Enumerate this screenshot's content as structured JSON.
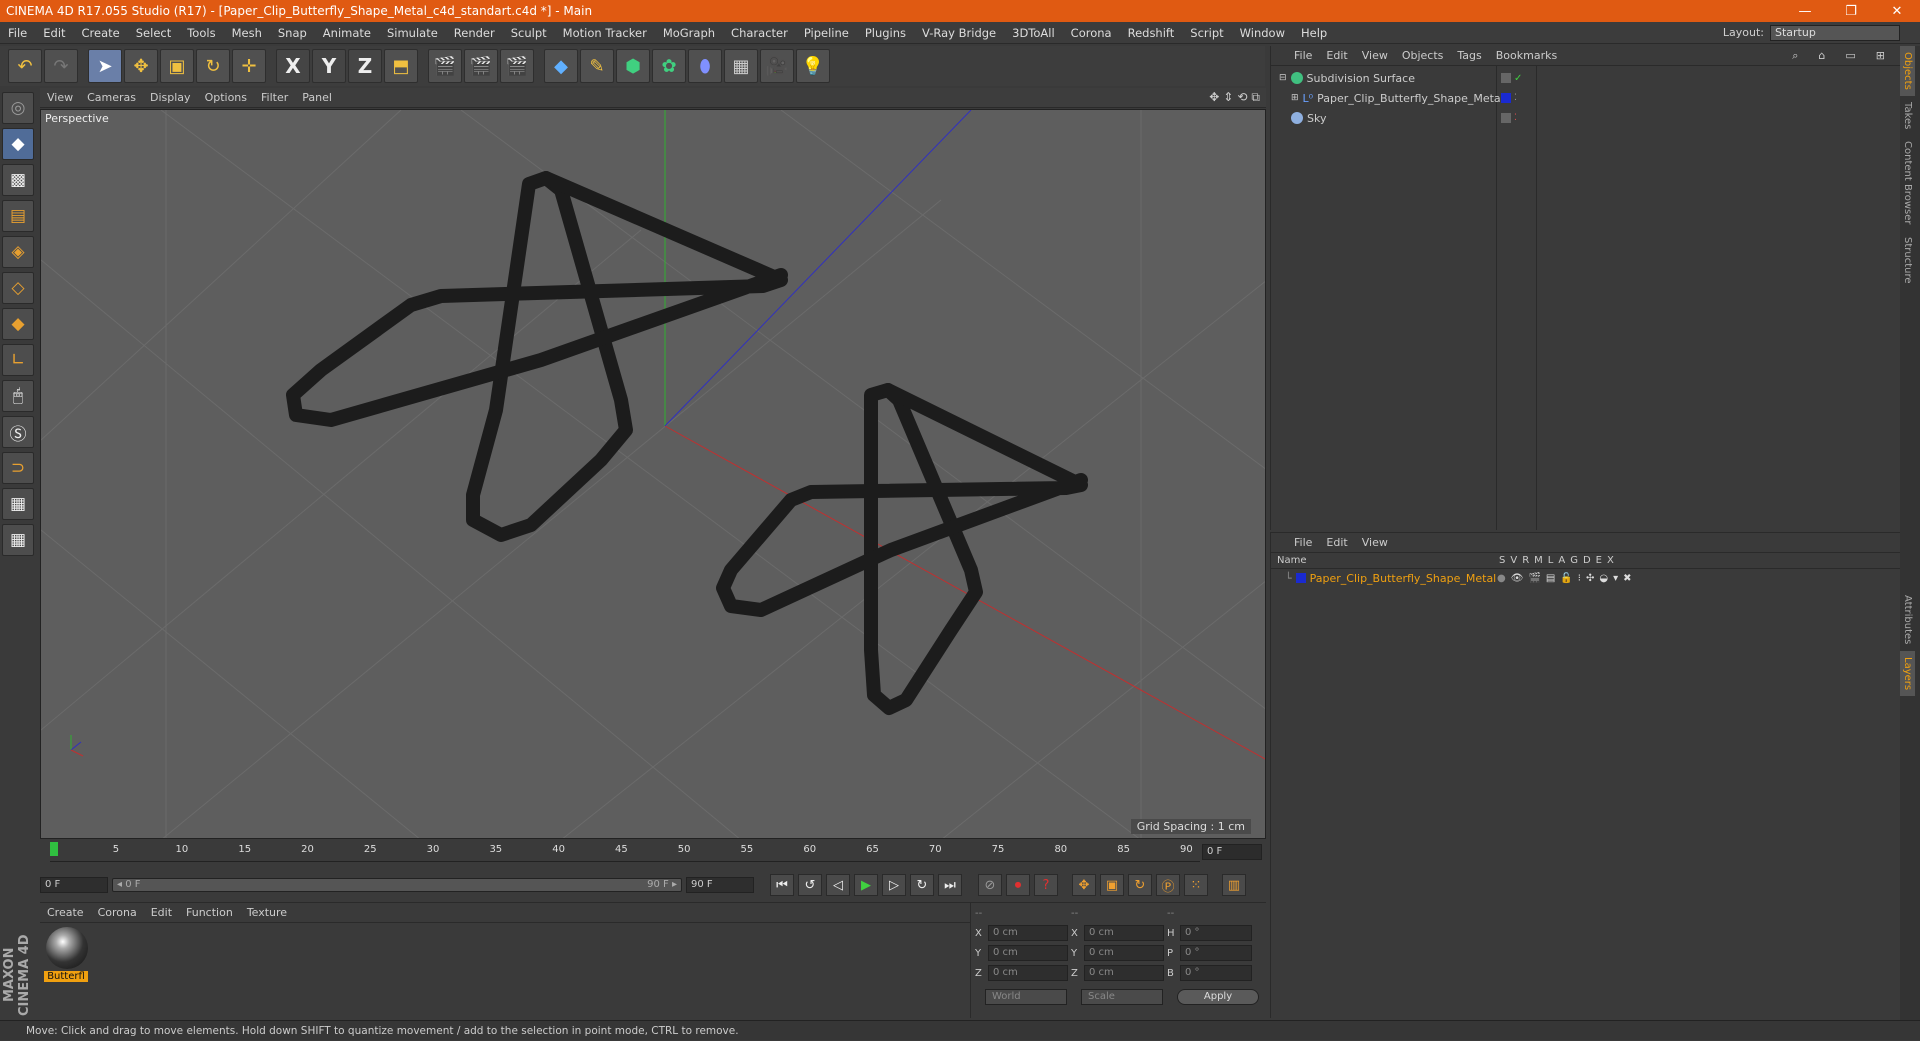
{
  "window": {
    "title": "CINEMA 4D R17.055 Studio (R17) - [Paper_Clip_Butterfly_Shape_Metal_c4d_standart.c4d *] - Main",
    "controls": [
      "—",
      "❐",
      "✕"
    ]
  },
  "menubar": {
    "items": [
      "File",
      "Edit",
      "Create",
      "Select",
      "Tools",
      "Mesh",
      "Snap",
      "Animate",
      "Simulate",
      "Render",
      "Sculpt",
      "Motion Tracker",
      "MoGraph",
      "Character",
      "Pipeline",
      "Plugins",
      "V-Ray Bridge",
      "3DToAll",
      "Corona",
      "Redshift",
      "Script",
      "Window",
      "Help"
    ],
    "layout_label": "Layout:",
    "layout_value": "Startup"
  },
  "toolbar": {
    "axis_x": "X",
    "axis_y": "Y",
    "axis_z": "Z"
  },
  "viewport": {
    "menu": [
      "View",
      "Cameras",
      "Display",
      "Options",
      "Filter",
      "Panel"
    ],
    "label": "Perspective",
    "grid_spacing": "Grid Spacing : 1 cm",
    "colors": {
      "bg": "#5e5e5e",
      "grid": "#6b6b6b",
      "x_axis": "#c03030",
      "y_axis": "#30b030",
      "z_axis": "#3030c0",
      "wire": "#1c1c1c"
    }
  },
  "timeline": {
    "ticks": [
      "0",
      "5",
      "10",
      "15",
      "20",
      "25",
      "30",
      "35",
      "40",
      "45",
      "50",
      "55",
      "60",
      "65",
      "70",
      "75",
      "80",
      "85",
      "90"
    ],
    "end_frame": "0 F",
    "start_field": "0 F",
    "range_start": "◂ 0 F",
    "range_end": "90 F ▸",
    "end_field": "90 F"
  },
  "material_manager": {
    "menu": [
      "Create",
      "Corona",
      "Edit",
      "Function",
      "Texture"
    ],
    "material_name": "Butterfl"
  },
  "coordinates": {
    "header": [
      "--",
      "--",
      "--"
    ],
    "rows": [
      {
        "a": "X",
        "av": "0 cm",
        "b": "X",
        "bv": "0 cm",
        "c": "H",
        "cv": "0 °"
      },
      {
        "a": "Y",
        "av": "0 cm",
        "b": "Y",
        "bv": "0 cm",
        "c": "P",
        "cv": "0 °"
      },
      {
        "a": "Z",
        "av": "0 cm",
        "b": "Z",
        "bv": "0 cm",
        "c": "B",
        "cv": "0 °"
      }
    ],
    "mode": "World",
    "scale": "Scale",
    "apply": "Apply"
  },
  "object_manager": {
    "menu": [
      "File",
      "Edit",
      "View",
      "Objects",
      "Tags",
      "Bookmarks"
    ],
    "objects": [
      {
        "name": "Subdivision Surface",
        "indent": 0,
        "color": "#40c080"
      },
      {
        "name": "Paper_Clip_Butterfly_Shape_Metal",
        "indent": 1,
        "color": "#6aa0ff"
      },
      {
        "name": "Sky",
        "indent": 0,
        "color": "#8fb0e0"
      }
    ]
  },
  "layer_manager": {
    "menu": [
      "File",
      "Edit",
      "View"
    ],
    "header_name": "Name",
    "columns": [
      "S",
      "V",
      "R",
      "M",
      "L",
      "A",
      "G",
      "D",
      "E",
      "X"
    ],
    "layers": [
      {
        "name": "Paper_Clip_Butterfly_Shape_Metal",
        "color": "#1a2ad0"
      }
    ]
  },
  "right_tabs": [
    "Objects",
    "Takes",
    "Content Browser",
    "Structure",
    "Attributes",
    "Layers"
  ],
  "status": "Move: Click and drag to move elements. Hold down SHIFT to quantize movement / add to the selection in point mode, CTRL to remove.",
  "logo": "MAXON CINEMA 4D"
}
